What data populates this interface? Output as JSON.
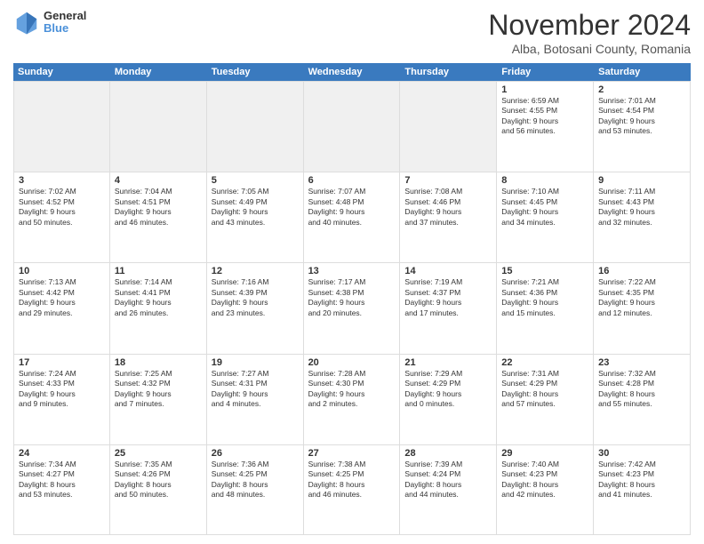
{
  "logo": {
    "line1": "General",
    "line2": "Blue"
  },
  "title": "November 2024",
  "location": "Alba, Botosani County, Romania",
  "header_days": [
    "Sunday",
    "Monday",
    "Tuesday",
    "Wednesday",
    "Thursday",
    "Friday",
    "Saturday"
  ],
  "weeks": [
    [
      {
        "day": "",
        "info": ""
      },
      {
        "day": "",
        "info": ""
      },
      {
        "day": "",
        "info": ""
      },
      {
        "day": "",
        "info": ""
      },
      {
        "day": "",
        "info": ""
      },
      {
        "day": "1",
        "info": "Sunrise: 6:59 AM\nSunset: 4:55 PM\nDaylight: 9 hours\nand 56 minutes."
      },
      {
        "day": "2",
        "info": "Sunrise: 7:01 AM\nSunset: 4:54 PM\nDaylight: 9 hours\nand 53 minutes."
      }
    ],
    [
      {
        "day": "3",
        "info": "Sunrise: 7:02 AM\nSunset: 4:52 PM\nDaylight: 9 hours\nand 50 minutes."
      },
      {
        "day": "4",
        "info": "Sunrise: 7:04 AM\nSunset: 4:51 PM\nDaylight: 9 hours\nand 46 minutes."
      },
      {
        "day": "5",
        "info": "Sunrise: 7:05 AM\nSunset: 4:49 PM\nDaylight: 9 hours\nand 43 minutes."
      },
      {
        "day": "6",
        "info": "Sunrise: 7:07 AM\nSunset: 4:48 PM\nDaylight: 9 hours\nand 40 minutes."
      },
      {
        "day": "7",
        "info": "Sunrise: 7:08 AM\nSunset: 4:46 PM\nDaylight: 9 hours\nand 37 minutes."
      },
      {
        "day": "8",
        "info": "Sunrise: 7:10 AM\nSunset: 4:45 PM\nDaylight: 9 hours\nand 34 minutes."
      },
      {
        "day": "9",
        "info": "Sunrise: 7:11 AM\nSunset: 4:43 PM\nDaylight: 9 hours\nand 32 minutes."
      }
    ],
    [
      {
        "day": "10",
        "info": "Sunrise: 7:13 AM\nSunset: 4:42 PM\nDaylight: 9 hours\nand 29 minutes."
      },
      {
        "day": "11",
        "info": "Sunrise: 7:14 AM\nSunset: 4:41 PM\nDaylight: 9 hours\nand 26 minutes."
      },
      {
        "day": "12",
        "info": "Sunrise: 7:16 AM\nSunset: 4:39 PM\nDaylight: 9 hours\nand 23 minutes."
      },
      {
        "day": "13",
        "info": "Sunrise: 7:17 AM\nSunset: 4:38 PM\nDaylight: 9 hours\nand 20 minutes."
      },
      {
        "day": "14",
        "info": "Sunrise: 7:19 AM\nSunset: 4:37 PM\nDaylight: 9 hours\nand 17 minutes."
      },
      {
        "day": "15",
        "info": "Sunrise: 7:21 AM\nSunset: 4:36 PM\nDaylight: 9 hours\nand 15 minutes."
      },
      {
        "day": "16",
        "info": "Sunrise: 7:22 AM\nSunset: 4:35 PM\nDaylight: 9 hours\nand 12 minutes."
      }
    ],
    [
      {
        "day": "17",
        "info": "Sunrise: 7:24 AM\nSunset: 4:33 PM\nDaylight: 9 hours\nand 9 minutes."
      },
      {
        "day": "18",
        "info": "Sunrise: 7:25 AM\nSunset: 4:32 PM\nDaylight: 9 hours\nand 7 minutes."
      },
      {
        "day": "19",
        "info": "Sunrise: 7:27 AM\nSunset: 4:31 PM\nDaylight: 9 hours\nand 4 minutes."
      },
      {
        "day": "20",
        "info": "Sunrise: 7:28 AM\nSunset: 4:30 PM\nDaylight: 9 hours\nand 2 minutes."
      },
      {
        "day": "21",
        "info": "Sunrise: 7:29 AM\nSunset: 4:29 PM\nDaylight: 9 hours\nand 0 minutes."
      },
      {
        "day": "22",
        "info": "Sunrise: 7:31 AM\nSunset: 4:29 PM\nDaylight: 8 hours\nand 57 minutes."
      },
      {
        "day": "23",
        "info": "Sunrise: 7:32 AM\nSunset: 4:28 PM\nDaylight: 8 hours\nand 55 minutes."
      }
    ],
    [
      {
        "day": "24",
        "info": "Sunrise: 7:34 AM\nSunset: 4:27 PM\nDaylight: 8 hours\nand 53 minutes."
      },
      {
        "day": "25",
        "info": "Sunrise: 7:35 AM\nSunset: 4:26 PM\nDaylight: 8 hours\nand 50 minutes."
      },
      {
        "day": "26",
        "info": "Sunrise: 7:36 AM\nSunset: 4:25 PM\nDaylight: 8 hours\nand 48 minutes."
      },
      {
        "day": "27",
        "info": "Sunrise: 7:38 AM\nSunset: 4:25 PM\nDaylight: 8 hours\nand 46 minutes."
      },
      {
        "day": "28",
        "info": "Sunrise: 7:39 AM\nSunset: 4:24 PM\nDaylight: 8 hours\nand 44 minutes."
      },
      {
        "day": "29",
        "info": "Sunrise: 7:40 AM\nSunset: 4:23 PM\nDaylight: 8 hours\nand 42 minutes."
      },
      {
        "day": "30",
        "info": "Sunrise: 7:42 AM\nSunset: 4:23 PM\nDaylight: 8 hours\nand 41 minutes."
      }
    ]
  ]
}
